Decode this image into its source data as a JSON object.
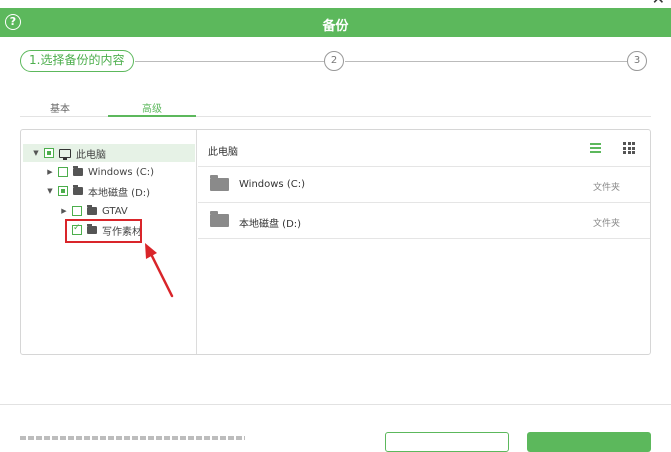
{
  "window": {
    "title": "备份",
    "help_icon": "help-circle-icon",
    "close_icon": "close-icon",
    "accent": "#5cb85c",
    "highlight_color": "#d9252a"
  },
  "steps": [
    {
      "label": "1.选择备份的内容",
      "active": true
    },
    {
      "label": "2",
      "active": false
    },
    {
      "label": "3",
      "active": false
    }
  ],
  "tabs": [
    {
      "label": "基本",
      "active": false
    },
    {
      "label": "高级",
      "active": true
    }
  ],
  "tree": [
    {
      "label": "此电脑",
      "icon": "computer-icon",
      "checkbox": "partial",
      "expanded": true,
      "selected": true
    },
    {
      "label": "Windows (C:)",
      "icon": "folder-icon",
      "checkbox": "unchecked",
      "expanded": false
    },
    {
      "label": "本地磁盘 (D:)",
      "icon": "folder-icon",
      "checkbox": "partial",
      "expanded": true
    },
    {
      "label": "GTAV",
      "icon": "folder-icon",
      "checkbox": "unchecked",
      "expanded": false
    },
    {
      "label": "写作素材",
      "icon": "folder-icon",
      "checkbox": "checked"
    }
  ],
  "right_pane": {
    "breadcrumb": "此电脑",
    "view_icons": [
      "list-view-icon",
      "grid-view-icon"
    ],
    "items": [
      {
        "name": "Windows (C:)",
        "type": "文件夹"
      },
      {
        "name": "本地磁盘 (D:)",
        "type": "文件夹"
      }
    ]
  }
}
